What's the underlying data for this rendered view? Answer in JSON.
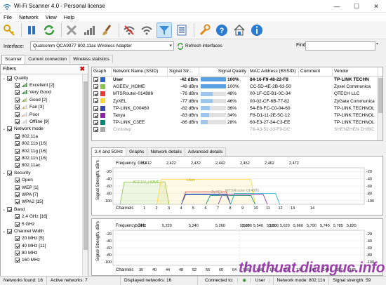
{
  "window": {
    "title": "Wi-Fi Scanner 4.0 - Personal license",
    "min": "—",
    "max": "☐",
    "close": "✕"
  },
  "menu": [
    "File",
    "Network",
    "View",
    "Help"
  ],
  "interface": {
    "label": "Interface:",
    "value": "Qualcomm QCA9377 802.11ac Wireless Adapter",
    "refresh_label": "Refresh interfaces",
    "find_label": "Find:"
  },
  "main_tabs": [
    "Scanner",
    "Current connection",
    "Wireless statistics"
  ],
  "filters": {
    "header": "Filters",
    "groups": [
      {
        "label": "Quality",
        "items": [
          "Excellent [2]",
          "Very Good",
          "Good [2]",
          "Fair [3]",
          "Poor",
          "Offline [9]"
        ]
      },
      {
        "label": "Network mode",
        "items": [
          "802.11a",
          "802.11b [16]",
          "802.11g [16]",
          "802.11n [16]",
          "802.11ac"
        ]
      },
      {
        "label": "Security",
        "items": [
          "Open",
          "WEP [1]",
          "WPA [7]",
          "WPA2 [15]"
        ]
      },
      {
        "label": "Band",
        "items": [
          "2.4 GHz [16]",
          "5 GHz"
        ]
      },
      {
        "label": "Channel Width",
        "items": [
          "20 MHz [5]",
          "40 MHz [11]",
          "80 MHz",
          "160 MHz"
        ]
      }
    ]
  },
  "table": {
    "headers": [
      "Graph",
      "Network Name (SSID)",
      "Signal Str...",
      "Signal Quality",
      "MAC Address (BSSID)",
      "Comment",
      "Vendor"
    ],
    "rows": [
      {
        "color": "#2b62c6",
        "ssid": "User",
        "signal": "-42 dBm",
        "quality": "100%",
        "q": 1.0,
        "mac": "84-16-F9-48-22-F8",
        "vendor": "TP-LINK TECHN"
      },
      {
        "color": "#8bc34a",
        "ssid": "AGEEV_HOME",
        "signal": "-49 dBm",
        "quality": "100%",
        "q": 1.0,
        "mac": "CC-5D-4E-2B-63-50",
        "vendor": "Zyxel Communica"
      },
      {
        "color": "#e53935",
        "ssid": "MTSRouter-014886",
        "signal": "-76 dBm",
        "quality": "48%",
        "q": 0.48,
        "mac": "00-1F-CE-B1-0C-34",
        "vendor": "QTECH LLC"
      },
      {
        "color": "#fdd835",
        "ssid": "ZyXEL",
        "signal": "-77 dBm",
        "quality": "46%",
        "q": 0.46,
        "mac": "00-02-CF-6B-77-82",
        "vendor": "ZyGate Communica"
      },
      {
        "color": "#3949ab",
        "ssid": "TP-LINK_C00460",
        "signal": "-82 dBm",
        "quality": "36%",
        "q": 0.36,
        "mac": "54-E6-FC-C0-04-60",
        "vendor": "TP-LINK TECHNOL"
      },
      {
        "color": "#8e24aa",
        "ssid": "Tanya",
        "signal": "-83 dBm",
        "quality": "34%",
        "q": 0.34,
        "mac": "F8-D1-11-2E-5C-12",
        "vendor": "TP-LINK TECHNOL"
      },
      {
        "color": "#00897b",
        "ssid": "TP-LINK_C3EE",
        "signal": "-86 dBm",
        "quality": "28%",
        "q": 0.28,
        "mac": "60-E3-27-34-C3-EE",
        "vendor": "TP-LINK TECHNOL"
      },
      {
        "color": "#aaaaaa",
        "ssid": "Contstep",
        "signal": "",
        "quality": "",
        "q": 0,
        "mac": "78-A3-51-33-F9-DC",
        "vendor": "SHENZHEN ZHIBC"
      }
    ]
  },
  "bottom_tabs": [
    "2.4 and 5GHz",
    "Graphs",
    "Network details",
    "Advanced details"
  ],
  "graph24": {
    "freq_label": "Frequency, GHz",
    "freqs": [
      "2,412",
      "2,422",
      "2,432",
      "2,442",
      "2,452",
      "2,462",
      "2,472"
    ],
    "ylabel": "Signal Strength, dBm",
    "yticks": [
      "-20",
      "-40",
      "-60",
      "-80",
      "-100"
    ],
    "channels_label": "Channels",
    "channels": [
      "1",
      "2",
      "3",
      "4",
      "5",
      "6",
      "7",
      "8",
      "9",
      "10",
      "11",
      "12",
      "13",
      "14"
    ],
    "labels": {
      "ageev": "AGEEV_HOME",
      "user": "User",
      "mts": "MTSRouter-014886",
      "zyxel": "ZyXEL",
      "tanya": "Tanya"
    }
  },
  "graph5": {
    "freq_label": "Frequency, GHz",
    "freqs_left": [
      "5,200",
      "5,220",
      "5,240",
      "5,260",
      "5,280",
      "5,300"
    ],
    "freqs_right": [
      "5,500",
      "5,540",
      "5,580",
      "5,620",
      "5,660",
      "5,700",
      "5,745",
      "5,785",
      "5,825"
    ],
    "ylabel": "Signal Strength, dBm",
    "yticks": [
      "-20",
      "-40",
      "-60",
      "-80",
      "-100"
    ],
    "channels_label": "Channels",
    "channels_left": [
      "36",
      "40",
      "44",
      "48",
      "52",
      "56",
      "60",
      "64"
    ],
    "channels_right": [
      "100",
      "108",
      "116",
      "124",
      "132",
      "140",
      "149",
      "157",
      "165"
    ]
  },
  "status": {
    "found": "Networks found: 16",
    "active": "Active networks: 7",
    "displayed": "Displayed networks: 16",
    "connected_label": "Connected to:",
    "connected": "User",
    "mode": "Network mode: 802.11n",
    "strength": "Signal strength: 59"
  },
  "watermark": "thuthuat.dianguc.info"
}
